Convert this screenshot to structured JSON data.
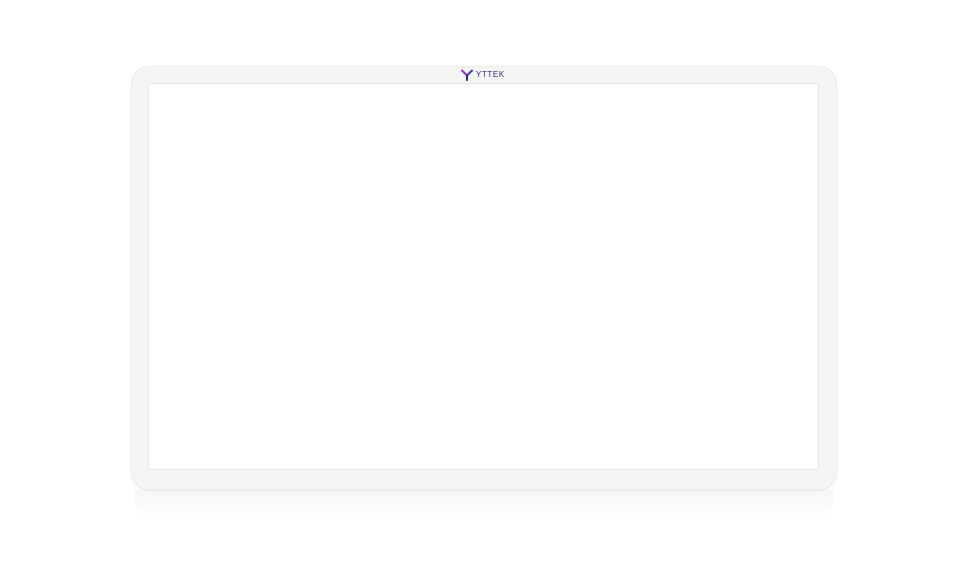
{
  "device": {
    "brand_name": "YTTEK",
    "brand_icon": "y-logo-icon",
    "colors": {
      "frame": "#f5f5f5",
      "screen": "#ffffff",
      "logo_left": "#9b2fd6",
      "logo_right": "#3a3fb6",
      "logo_stem": "#2a2e7a"
    }
  }
}
